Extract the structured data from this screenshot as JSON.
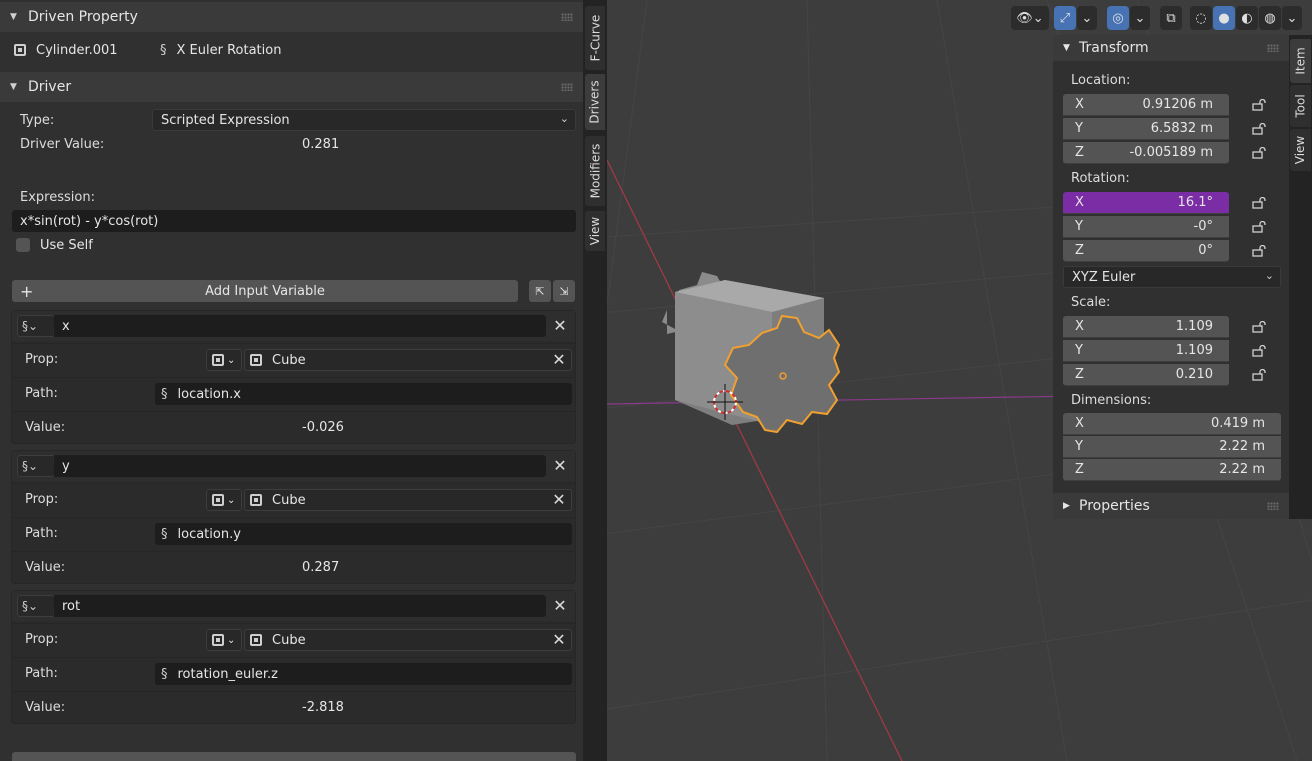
{
  "driven_property": {
    "title": "Driven Property",
    "object": "Cylinder.001",
    "property": "X Euler Rotation"
  },
  "driver": {
    "title": "Driver",
    "type_label": "Type:",
    "type_value": "Scripted Expression",
    "value_label": "Driver Value:",
    "value": "0.281",
    "expression_label": "Expression:",
    "expression": "x*sin(rot) - y*cos(rot)",
    "use_self": "Use Self",
    "add_variable": "Add Input Variable"
  },
  "variables": [
    {
      "name": "x",
      "prop_label": "Prop:",
      "target": "Cube",
      "path_label": "Path:",
      "path": "location.x",
      "value_label": "Value:",
      "value": "-0.026"
    },
    {
      "name": "y",
      "prop_label": "Prop:",
      "target": "Cube",
      "path_label": "Path:",
      "path": "location.y",
      "value_label": "Value:",
      "value": "0.287"
    },
    {
      "name": "rot",
      "prop_label": "Prop:",
      "target": "Cube",
      "path_label": "Path:",
      "path": "rotation_euler.z",
      "value_label": "Value:",
      "value": "-2.818"
    }
  ],
  "side_tabs": [
    "F-Curve",
    "Drivers",
    "Modifiers",
    "View"
  ],
  "active_side_tab": "Drivers",
  "transform": {
    "title": "Transform",
    "location_label": "Location:",
    "location": [
      {
        "axis": "X",
        "value": "0.91206 m"
      },
      {
        "axis": "Y",
        "value": "6.5832 m"
      },
      {
        "axis": "Z",
        "value": "-0.005189 m"
      }
    ],
    "rotation_label": "Rotation:",
    "rotation": [
      {
        "axis": "X",
        "value": "16.1°"
      },
      {
        "axis": "Y",
        "value": "-0°"
      },
      {
        "axis": "Z",
        "value": "0°"
      }
    ],
    "rotation_mode": "XYZ Euler",
    "scale_label": "Scale:",
    "scale": [
      {
        "axis": "X",
        "value": "1.109"
      },
      {
        "axis": "Y",
        "value": "1.109"
      },
      {
        "axis": "Z",
        "value": "0.210"
      }
    ],
    "dimensions_label": "Dimensions:",
    "dimensions": [
      {
        "axis": "X",
        "value": "0.419 m"
      },
      {
        "axis": "Y",
        "value": "2.22 m"
      },
      {
        "axis": "Z",
        "value": "2.22 m"
      }
    ],
    "properties_title": "Properties"
  },
  "n_tabs": [
    "Item",
    "Tool",
    "View"
  ],
  "colors": {
    "accent_driver": "#7a2da5",
    "selection_outline": "#f0a030",
    "header_blue": "#4772b3"
  }
}
